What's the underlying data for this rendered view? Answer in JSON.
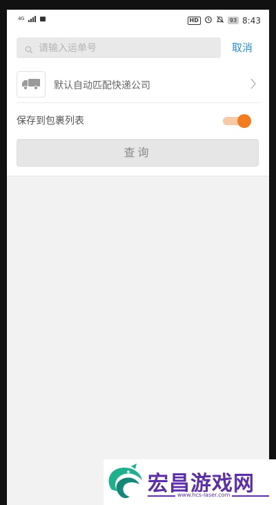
{
  "status_bar": {
    "network": "4G",
    "hd": "HD",
    "battery": "93",
    "time": "8:43"
  },
  "search": {
    "placeholder": "请输入运单号",
    "value": "",
    "cancel_label": "取消"
  },
  "company": {
    "label": "默认自动匹配快递公司"
  },
  "save": {
    "label": "保存到包裹列表",
    "enabled": true,
    "accent": "#f47c20"
  },
  "query_button": {
    "label": "查询"
  },
  "watermark": {
    "title": "宏昌游戏网",
    "url": "www.hcs-laser.com"
  }
}
